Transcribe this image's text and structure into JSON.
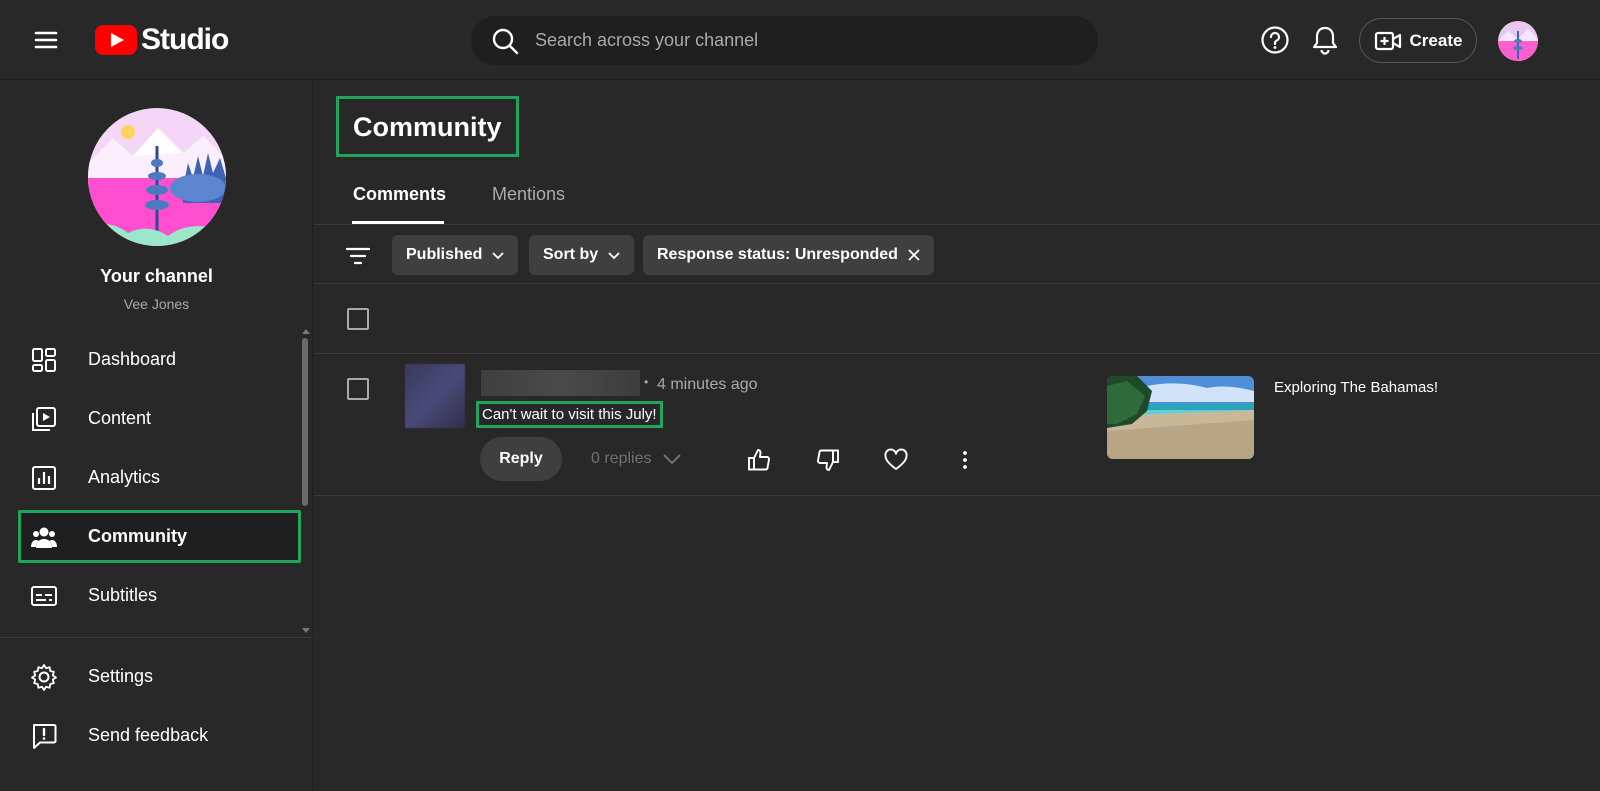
{
  "header": {
    "logo_text": "Studio",
    "search_placeholder": "Search across your channel",
    "create_label": "Create"
  },
  "sidebar": {
    "channel_title": "Your channel",
    "channel_name": "Vee Jones",
    "items": [
      {
        "label": "Dashboard",
        "icon": "dashboard-icon"
      },
      {
        "label": "Content",
        "icon": "content-icon"
      },
      {
        "label": "Analytics",
        "icon": "analytics-icon"
      },
      {
        "label": "Community",
        "icon": "community-icon",
        "active": true
      },
      {
        "label": "Subtitles",
        "icon": "subtitles-icon"
      }
    ],
    "bottom_items": [
      {
        "label": "Settings",
        "icon": "gear-icon"
      },
      {
        "label": "Send feedback",
        "icon": "feedback-icon"
      }
    ]
  },
  "main": {
    "title": "Community",
    "tabs": [
      {
        "label": "Comments",
        "active": true
      },
      {
        "label": "Mentions"
      }
    ],
    "filters": {
      "published": "Published",
      "sort_by": "Sort by",
      "response_status": "Response status: Unresponded"
    },
    "comment": {
      "timestamp": "4 minutes ago",
      "text": "Can't wait to visit this July!",
      "reply_label": "Reply",
      "replies_label": "0 replies",
      "video_title": "Exploring The Bahamas!"
    }
  },
  "colors": {
    "background": "#282828",
    "highlight": "#22a45a",
    "brand_red": "#ff0000"
  }
}
